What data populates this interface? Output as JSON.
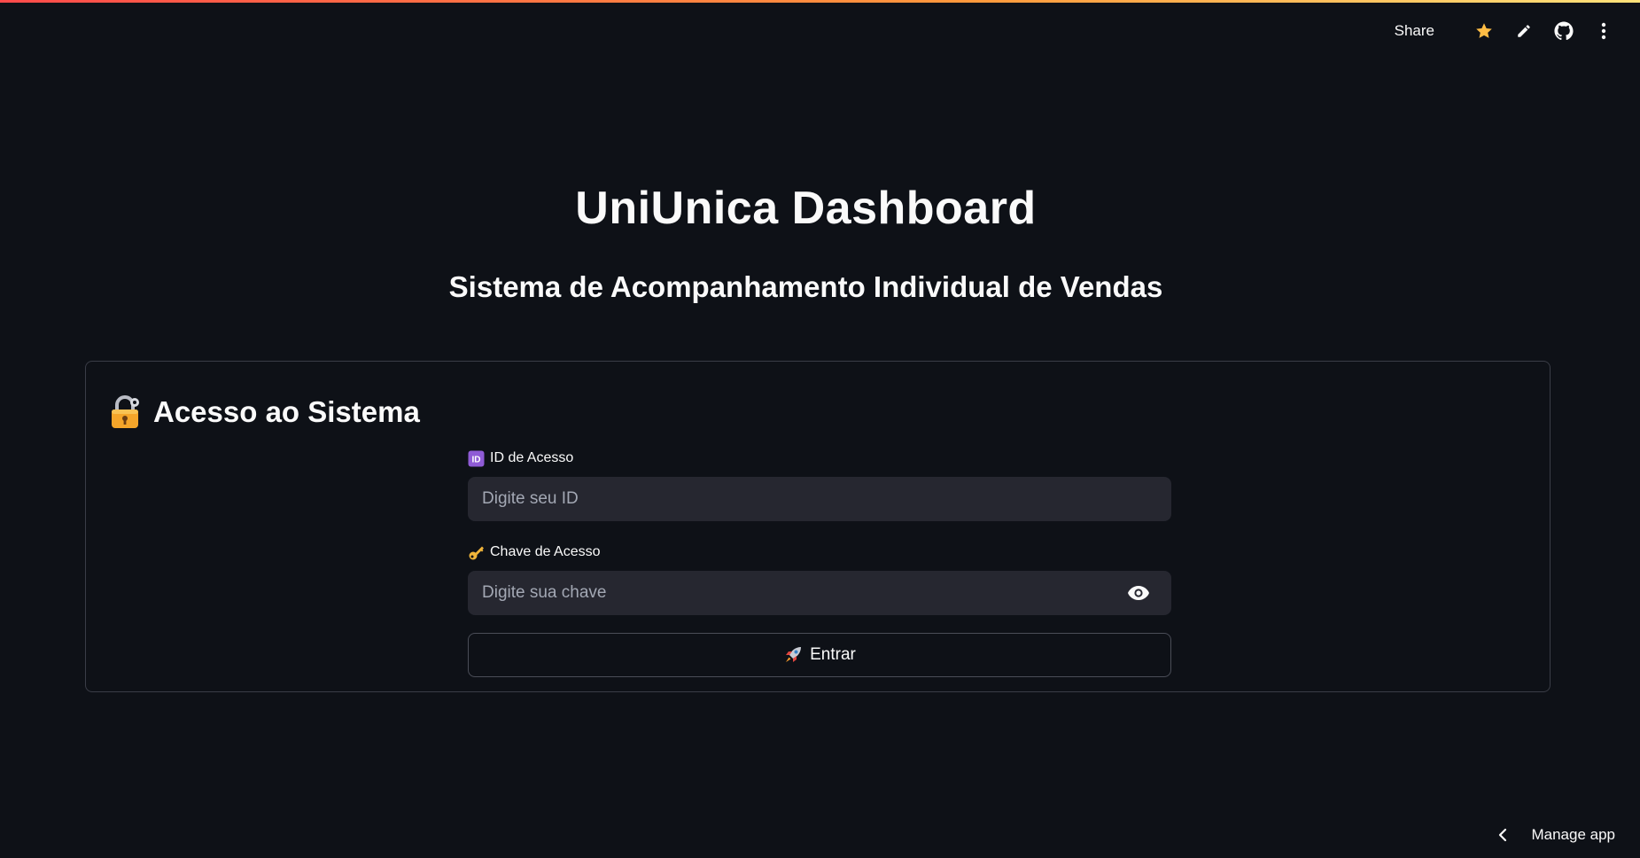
{
  "toolbar": {
    "share_label": "Share",
    "icons": [
      "star-icon",
      "pencil-icon",
      "github-icon",
      "more-vertical-icon"
    ],
    "star_color": "#ffbd45"
  },
  "header": {
    "title": "UniUnica Dashboard",
    "subtitle": "Sistema de Acompanhamento Individual de Vendas"
  },
  "login": {
    "heading": "Acesso ao Sistema",
    "heading_icon": "locked-with-key-icon",
    "id_field": {
      "label": "ID de Acesso",
      "icon": "id-badge-icon",
      "placeholder": "Digite seu ID",
      "value": ""
    },
    "key_field": {
      "label": "Chave de Acesso",
      "icon": "key-icon",
      "placeholder": "Digite sua chave",
      "value": ""
    },
    "submit_label": "Entrar",
    "submit_icon": "rocket-icon"
  },
  "footer": {
    "manage_label": "Manage app"
  },
  "colors": {
    "background": "#0e1117",
    "input_bg": "#262730",
    "text": "#fafafa",
    "border": "#3a3d47"
  }
}
